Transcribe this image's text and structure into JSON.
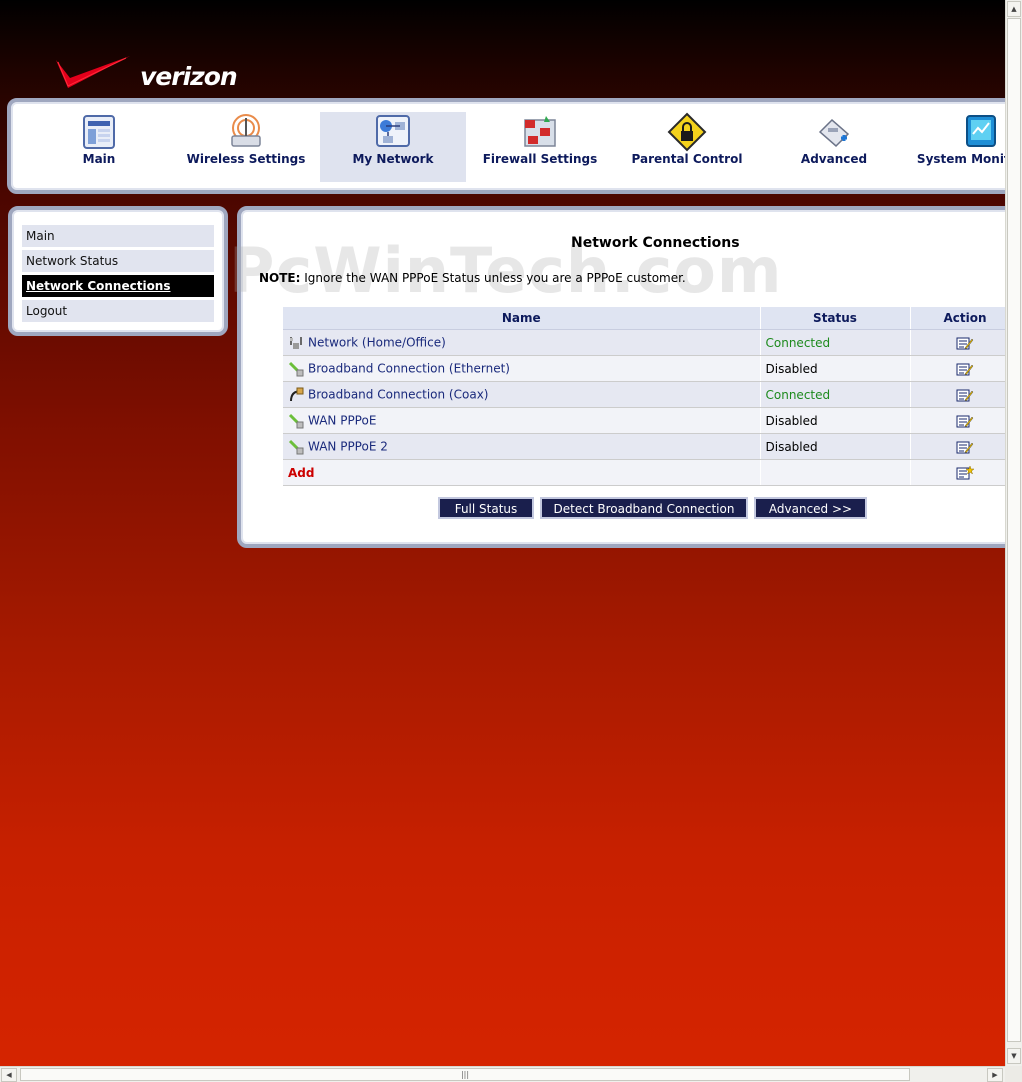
{
  "brand": {
    "logo_text": "verizon"
  },
  "nav": {
    "items": [
      {
        "label": "Main",
        "icon": "main-icon"
      },
      {
        "label": "Wireless Settings",
        "icon": "wireless-icon"
      },
      {
        "label": "My Network",
        "icon": "my-network-icon",
        "active": true
      },
      {
        "label": "Firewall Settings",
        "icon": "firewall-icon"
      },
      {
        "label": "Parental Control",
        "icon": "parental-lock-icon"
      },
      {
        "label": "Advanced",
        "icon": "advanced-icon"
      },
      {
        "label": "System Monitoring",
        "icon": "system-monitoring-icon"
      }
    ]
  },
  "sidebar": {
    "items": [
      {
        "label": "Main"
      },
      {
        "label": "Network Status"
      },
      {
        "label": "Network Connections",
        "active": true
      },
      {
        "label": "Logout"
      }
    ]
  },
  "main": {
    "title": "Network Connections",
    "watermark": "PcWinTech.com",
    "note_prefix": "NOTE:",
    "note_text": " Ignore the WAN PPPoE Status unless you are a PPPoE customer.",
    "table": {
      "headers": {
        "name": "Name",
        "status": "Status",
        "action": "Action"
      },
      "rows": [
        {
          "name": "Network (Home/Office)",
          "status": "Connected",
          "icon": "network-home-icon"
        },
        {
          "name": "Broadband Connection (Ethernet)",
          "status": "Disabled",
          "icon": "ethernet-cable-icon"
        },
        {
          "name": "Broadband Connection (Coax)",
          "status": "Connected",
          "icon": "coax-cable-icon"
        },
        {
          "name": "WAN PPPoE",
          "status": "Disabled",
          "icon": "ethernet-cable-icon"
        },
        {
          "name": "WAN PPPoE 2",
          "status": "Disabled",
          "icon": "ethernet-cable-icon"
        }
      ],
      "add_label": "Add"
    },
    "buttons": {
      "full_status": "Full Status",
      "detect": "Detect Broadband Connection",
      "advanced": "Advanced >>"
    }
  },
  "colors": {
    "nav_text": "#0d1a5c",
    "connected": "#1d8a1d",
    "add": "#cc0000",
    "button_bg": "#1a1f4d"
  }
}
